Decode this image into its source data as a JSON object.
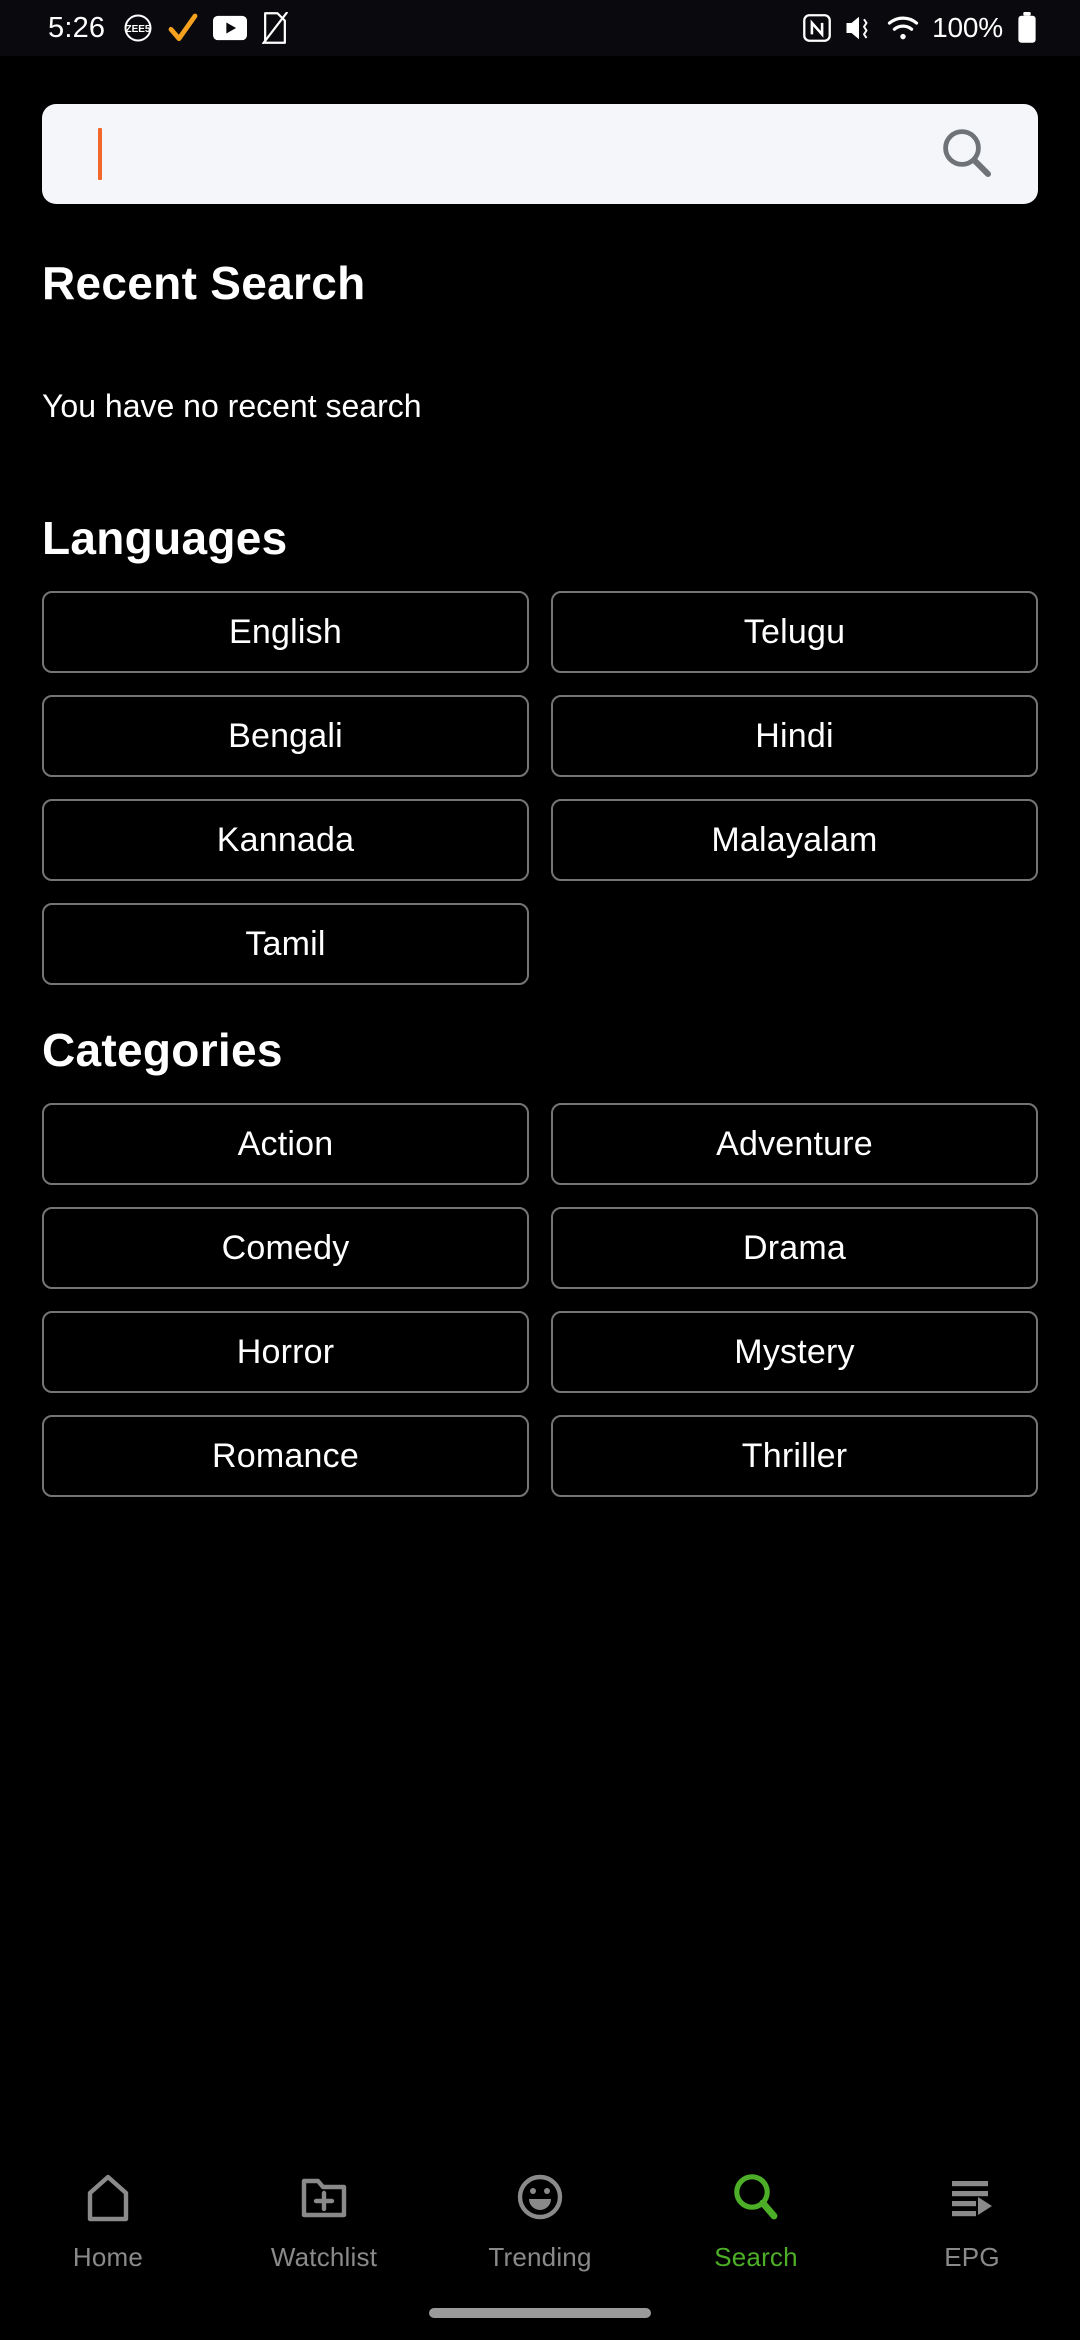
{
  "status_bar": {
    "time": "5:26",
    "battery_percent": "100%",
    "left_icons": [
      "zee5-app-icon",
      "orange-checkmark-icon",
      "youtube-icon",
      "document-off-icon"
    ],
    "right_icons": [
      "nfc-icon",
      "volume-mute-vibrate-icon",
      "wifi-icon",
      "battery-full-icon"
    ]
  },
  "search": {
    "value": "",
    "placeholder": "",
    "icon": "search-icon",
    "caret_color": "#f2682a",
    "background": "#f4f6fa"
  },
  "recent": {
    "title": "Recent Search",
    "empty_message": "You have no recent search"
  },
  "languages": {
    "title": "Languages",
    "items": [
      "English",
      "Telugu",
      "Bengali",
      "Hindi",
      "Kannada",
      "Malayalam",
      "Tamil"
    ]
  },
  "categories": {
    "title": "Categories",
    "items": [
      "Action",
      "Adventure",
      "Comedy",
      "Drama",
      "Horror",
      "Mystery",
      "Romance",
      "Thriller"
    ]
  },
  "bottom_nav": {
    "active_color": "#4caf27",
    "inactive_color": "#8a8a8a",
    "items": [
      {
        "label": "Home",
        "icon": "home-icon",
        "active": false
      },
      {
        "label": "Watchlist",
        "icon": "folder-plus-icon",
        "active": false
      },
      {
        "label": "Trending",
        "icon": "smiley-icon",
        "active": false
      },
      {
        "label": "Search",
        "icon": "search-icon",
        "active": true
      },
      {
        "label": "EPG",
        "icon": "epg-list-icon",
        "active": false
      }
    ]
  }
}
